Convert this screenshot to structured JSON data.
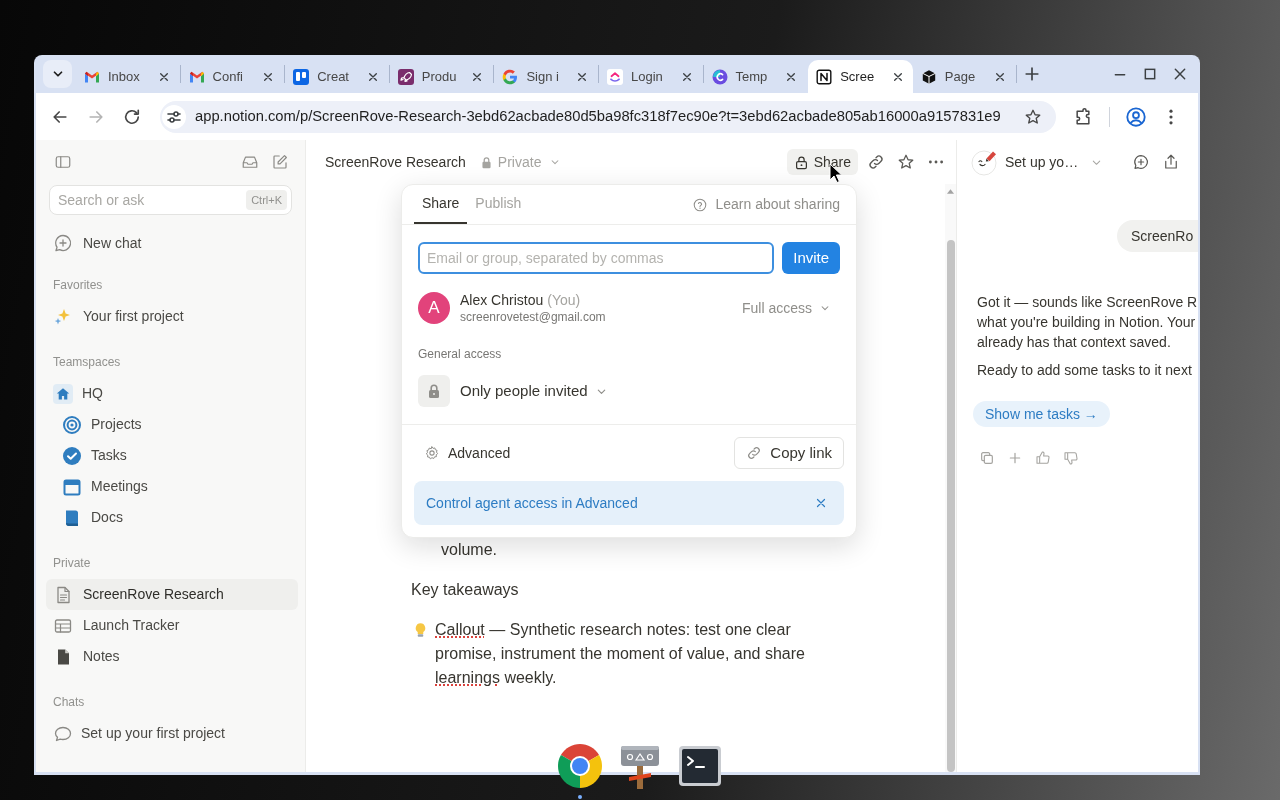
{
  "browser": {
    "tabs": [
      {
        "kind": "mail",
        "title": "Inbox",
        "selected": false
      },
      {
        "kind": "mail",
        "title": "Confi",
        "selected": false
      },
      {
        "kind": "board",
        "title": "Creat",
        "selected": false
      },
      {
        "kind": "rocket",
        "title": "Produ",
        "selected": false
      },
      {
        "kind": "google",
        "title": "Sign i",
        "selected": false
      },
      {
        "kind": "loop",
        "title": "Login",
        "selected": false
      },
      {
        "kind": "canva",
        "title": "Temp",
        "selected": false
      },
      {
        "kind": "notion",
        "title": "Scree",
        "selected": true
      },
      {
        "kind": "cube",
        "title": "Page",
        "selected": false
      }
    ],
    "url": "app.notion.com/p/ScreenRove-Research-3ebd62acbade80d5ba98fc318f7ec90e?t=3ebd62acbade805ab16000a9157831e9"
  },
  "sidebar": {
    "search": {
      "placeholder": "Search or ask",
      "shortcut": "Ctrl+K"
    },
    "new_chat": "New chat",
    "sections": [
      {
        "title": "Favorites",
        "items": [
          {
            "kind": "sparkles",
            "label": "Your first project",
            "selected": false
          }
        ]
      },
      {
        "title": "Teamspaces",
        "items": [
          {
            "kind": "home",
            "label": "HQ",
            "selected": false,
            "children": [
              {
                "kind": "target",
                "label": "Projects",
                "selected": false
              },
              {
                "kind": "check",
                "label": "Tasks",
                "selected": false
              },
              {
                "kind": "calendar",
                "label": "Meetings",
                "selected": false
              },
              {
                "kind": "book",
                "label": "Docs",
                "selected": false
              }
            ]
          }
        ]
      },
      {
        "title": "Private",
        "items": [
          {
            "kind": "page",
            "label": "ScreenRove Research",
            "selected": true
          },
          {
            "kind": "table",
            "label": "Launch Tracker",
            "selected": false
          },
          {
            "kind": "note",
            "label": "Notes",
            "selected": false
          }
        ]
      },
      {
        "title": "Chats",
        "items": [
          {
            "kind": "chat",
            "label": "Set up your first project",
            "selected": false
          }
        ]
      }
    ]
  },
  "page": {
    "title": "ScreenRove Research",
    "visibility": "Private",
    "share_label": "Share",
    "blocks": [
      {
        "kind": "list_continuation",
        "text": "volume."
      },
      {
        "kind": "paragraph",
        "text": "Key takeaways"
      },
      {
        "kind": "callout",
        "segments": [
          {
            "text": "Callout",
            "misspelled": true
          },
          {
            "text": " — Synthetic research notes: test one clear promise, instrument the moment of value, and share ",
            "misspelled": false
          },
          {
            "text": "learnings",
            "misspelled": true
          },
          {
            "text": " weekly.",
            "misspelled": false
          }
        ]
      }
    ]
  },
  "share_popup": {
    "tabs": [
      {
        "label": "Share",
        "selected": true
      },
      {
        "label": "Publish",
        "selected": false
      }
    ],
    "help_link": "Learn about sharing",
    "invite": {
      "placeholder": "Email or group, separated by commas",
      "button": "Invite"
    },
    "members": [
      {
        "initial": "A",
        "name": "Alex Christou",
        "note": "(You)",
        "email": "screenrovetest@gmail.com",
        "access": "Full access"
      }
    ],
    "general_access": {
      "label": "General access",
      "value": "Only people invited"
    },
    "advanced": "Advanced",
    "copy_link": "Copy link",
    "banner": {
      "text": "Control agent access in Advanced",
      "dismissible": true
    }
  },
  "assistant": {
    "chat_title": "Set up yo…",
    "user_message": "ScreenRo",
    "reply": [
      {
        "lines": [
          "Got it — sounds like ScreenRove R",
          "what you're building in Notion. Your",
          "already has that context saved."
        ]
      },
      {
        "lines": [
          "Ready to add some tasks to it next"
        ]
      }
    ],
    "suggestion": "Show me tasks →"
  },
  "dock": [
    {
      "kind": "browser",
      "running": true
    },
    {
      "kind": "signpost",
      "running": false
    },
    {
      "kind": "terminal",
      "running": false
    }
  ]
}
